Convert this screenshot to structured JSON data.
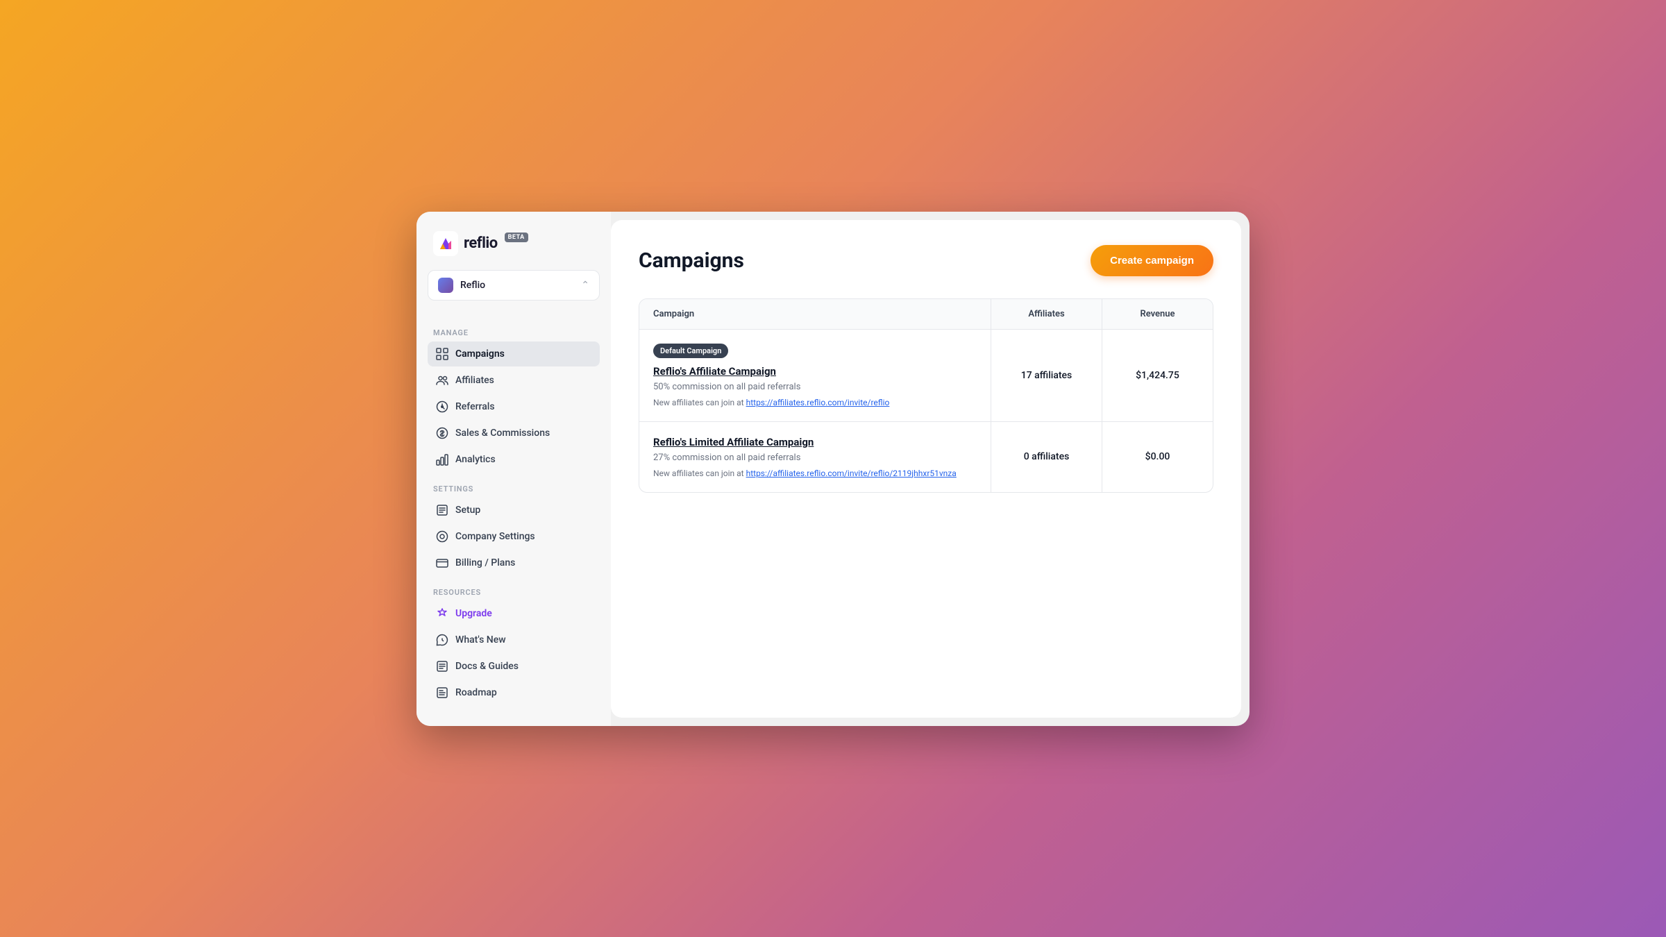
{
  "app": {
    "name": "reflio",
    "beta_label": "BETA",
    "logo_alt": "Reflio logo"
  },
  "workspace": {
    "name": "Reflio",
    "chevron": "⌃"
  },
  "sidebar": {
    "manage_label": "MANAGE",
    "settings_label": "SETTINGS",
    "resources_label": "RESOURCES",
    "nav_items_manage": [
      {
        "id": "campaigns",
        "label": "Campaigns",
        "active": true
      },
      {
        "id": "affiliates",
        "label": "Affiliates",
        "active": false
      },
      {
        "id": "referrals",
        "label": "Referrals",
        "active": false
      },
      {
        "id": "sales",
        "label": "Sales & Commissions",
        "active": false
      },
      {
        "id": "analytics",
        "label": "Analytics",
        "active": false
      }
    ],
    "nav_items_settings": [
      {
        "id": "setup",
        "label": "Setup",
        "active": false
      },
      {
        "id": "company",
        "label": "Company Settings",
        "active": false
      },
      {
        "id": "billing",
        "label": "Billing / Plans",
        "active": false
      }
    ],
    "nav_items_resources": [
      {
        "id": "upgrade",
        "label": "Upgrade",
        "active": false,
        "highlight": true
      },
      {
        "id": "whats-new",
        "label": "What's New",
        "active": false
      },
      {
        "id": "docs",
        "label": "Docs & Guides",
        "active": false
      },
      {
        "id": "roadmap",
        "label": "Roadmap",
        "active": false
      }
    ]
  },
  "page": {
    "title": "Campaigns",
    "create_button": "Create campaign"
  },
  "table": {
    "columns": [
      "Campaign",
      "Affiliates",
      "Revenue"
    ],
    "rows": [
      {
        "default_badge": "Default Campaign",
        "name": "Reflio's Affiliate Campaign",
        "description": "50% commission on all paid referrals",
        "link_prefix": "New affiliates can join at",
        "link": "https://affiliates.reflio.com/invite/reflio",
        "affiliates": "17 affiliates",
        "revenue": "$1,424.75"
      },
      {
        "default_badge": "",
        "name": "Reflio's Limited Affiliate Campaign",
        "description": "27% commission on all paid referrals",
        "link_prefix": "New affiliates can join at",
        "link": "https://affiliates.reflio.com/invite/reflio/2119jhhxr51vnza",
        "affiliates": "0 affiliates",
        "revenue": "$0.00"
      }
    ]
  }
}
